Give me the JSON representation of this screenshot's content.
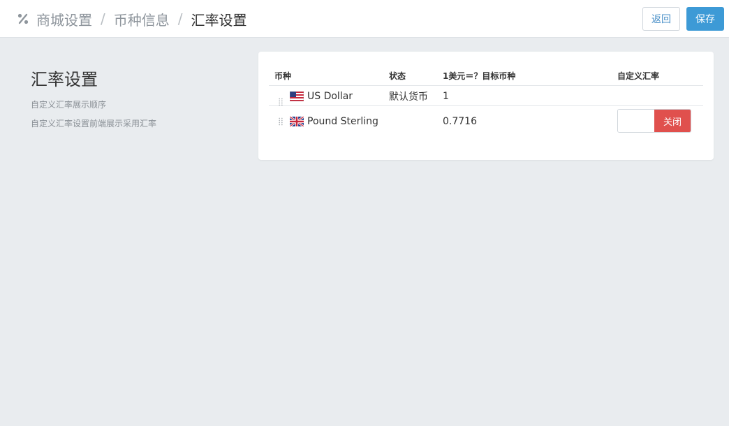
{
  "breadcrumb": {
    "icon": "percent-icon",
    "items": [
      "商城设置",
      "币种信息",
      "汇率设置"
    ],
    "separator": "/"
  },
  "actions": {
    "back_label": "返回",
    "save_label": "保存",
    "accent": "#3d9ad6"
  },
  "side": {
    "title": "汇率设置",
    "desc1": "自定义汇率展示顺序",
    "desc2": "自定义汇率设置前端展示采用汇率"
  },
  "table": {
    "headers": {
      "currency": "币种",
      "status": "状态",
      "rate": "1美元＝？目标币种",
      "custom": "自定义汇率"
    },
    "rows": [
      {
        "flag": "us-flag-icon",
        "name": "US Dollar",
        "status": "默认货币",
        "rate": "1"
      },
      {
        "flag": "uk-flag-icon",
        "name": "Pound Sterling",
        "status": "",
        "rate": "0.7716",
        "custom_input": "",
        "toggle_label": "关闭",
        "toggle_color": "#e0504d"
      }
    ]
  }
}
